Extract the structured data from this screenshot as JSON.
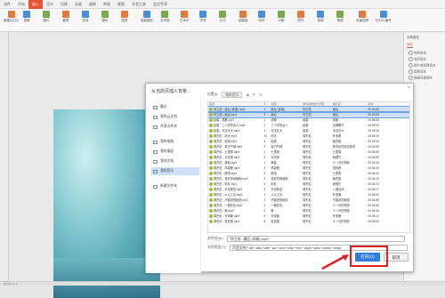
{
  "menu": [
    "文件",
    "开始",
    "插入",
    "设计",
    "切换",
    "动画",
    "放映",
    "审阅",
    "视图",
    "开发工具",
    "会员专享"
  ],
  "menu_active": "插入",
  "ribbon_buttons": [
    "新建幻灯片",
    "表格",
    "图片",
    "截屏",
    "形状",
    "图标",
    "图表",
    "智能图形",
    "文本框",
    "艺术字",
    "符号",
    "公式",
    "超链接",
    "动作",
    "对象",
    "附件",
    "音频",
    "视频",
    "页眉页脚",
    "幻灯片编号"
  ],
  "right_panel": {
    "title": "对象属性",
    "tab": "填充",
    "options": [
      "纯色填充",
      "渐变填充",
      "图片或纹理填充",
      "图案填充",
      "隐藏背景图形"
    ]
  },
  "dialog": {
    "title": "从当前页插入背景...",
    "close_label": "×",
    "sidebar": [
      "最近",
      "我的云文档",
      "共享文件夹",
      "我的电脑",
      "我的桌面",
      "我的文档",
      "我的音乐",
      "新建文件夹"
    ],
    "sidebar_selected": 6,
    "location_label": "位置(I):",
    "folder": "我的音乐",
    "columns": [
      "名称",
      "#",
      "标题",
      "参与创作的艺术家",
      "唱片集",
      "时长"
    ],
    "files": [
      {
        "name": "你立刻 - 最后 (伴奏).mp3",
        "num": "4",
        "title": "最后 (伴奏)",
        "artist": "你立刻",
        "album": "最后",
        "dur": "00:03:56",
        "sel": true
      },
      {
        "name": "你立刻 - 最后.mp3",
        "num": "4",
        "title": "最后",
        "artist": "你立刻",
        "album": "最后",
        "dur": "00:03:56",
        "sel": true
      },
      {
        "name": "赵雷 - 成都.mp3",
        "num": "1",
        "title": "成都",
        "artist": "赵雷",
        "album": "成都",
        "dur": "00:05:28",
        "sel": false
      },
      {
        "name": "赵雷 - 三十岁的女人.mp3",
        "num": "2",
        "title": "三十岁的女人",
        "artist": "赵雷",
        "album": "吉姆餐厅",
        "dur": "00:05:34",
        "sel": false
      },
      {
        "name": "赵雷 - 无法长大.mp3",
        "num": "3",
        "title": "无法长大",
        "artist": "赵雷",
        "album": "无法长大",
        "dur": "00:03:46",
        "sel": false
      },
      {
        "name": "周杰伦 - 晴天.mp3",
        "num": "10",
        "title": "晴天",
        "artist": "周杰伦",
        "album": "叶惠美",
        "dur": "00:04:29",
        "sel": false
      },
      {
        "name": "周杰伦 - 稻香.mp3",
        "num": "4",
        "title": "稻香",
        "artist": "周杰伦",
        "album": "魔杰座",
        "dur": "00:03:43",
        "sel": false
      },
      {
        "name": "周杰伦 - 告白气球.mp3",
        "num": "9",
        "title": "告白气球",
        "artist": "周杰伦",
        "album": "周杰伦的床边故事",
        "dur": "00:03:35",
        "sel": false
      },
      {
        "name": "周杰伦 - 七里香.mp3",
        "num": "1",
        "title": "七里香",
        "artist": "周杰伦",
        "album": "七里香",
        "dur": "00:04:59",
        "sel": false
      },
      {
        "name": "周杰伦 - 青花瓷.mp3",
        "num": "5",
        "title": "青花瓷",
        "artist": "周杰伦",
        "album": "我很忙",
        "dur": "00:03:59",
        "sel": false
      },
      {
        "name": "周杰伦 - 夜曲.mp3",
        "num": "1",
        "title": "夜曲",
        "artist": "周杰伦",
        "album": "十一月的萧邦",
        "dur": "00:03:46",
        "sel": false
      },
      {
        "name": "周杰伦 - 简单爱.mp3",
        "num": "4",
        "title": "简单爱",
        "artist": "周杰伦",
        "album": "范特西",
        "dur": "00:04:30",
        "sel": false
      },
      {
        "name": "周杰伦 - 搁浅.mp3",
        "num": "5",
        "title": "搁浅",
        "artist": "周杰伦",
        "album": "七里香",
        "dur": "00:04:00",
        "sel": false
      },
      {
        "name": "周杰伦 - 说好的幸福呢.mp3",
        "num": "2",
        "title": "说好的幸福呢",
        "artist": "周杰伦",
        "album": "魔杰座",
        "dur": "00:04:15",
        "sel": false
      },
      {
        "name": "周杰伦 - 彩虹.mp3",
        "num": "6",
        "title": "彩虹",
        "artist": "周杰伦",
        "album": "我很忙",
        "dur": "00:04:23",
        "sel": false
      },
      {
        "name": "周杰伦 - 半岛铁盒.mp3",
        "num": "3",
        "title": "半岛铁盒",
        "artist": "周杰伦",
        "album": "八度空间",
        "dur": "00:05:17",
        "sel": false
      },
      {
        "name": "周杰伦 - 以父之名.mp3",
        "num": "1",
        "title": "以父之名",
        "artist": "周杰伦",
        "album": "叶惠美",
        "dur": "00:05:42",
        "sel": false
      },
      {
        "name": "周杰伦 - 不能说的秘密.mp3",
        "num": "1",
        "title": "不能说的秘密",
        "artist": "周杰伦",
        "album": "不能说的秘密",
        "dur": "00:04:56",
        "sel": false
      },
      {
        "name": "周杰伦 - 一路向北.mp3",
        "num": "2",
        "title": "一路向北",
        "artist": "周杰伦",
        "album": "十一月的萧邦",
        "dur": "00:04:55",
        "sel": false
      },
      {
        "name": "周杰伦 - 枫.mp3",
        "num": "2",
        "title": "枫",
        "artist": "周杰伦",
        "album": "十一月的萧邦",
        "dur": "00:04:36",
        "sel": false
      },
      {
        "name": "周杰伦 - 东风破.mp3",
        "num": "5",
        "title": "东风破",
        "artist": "周杰伦",
        "album": "叶惠美",
        "dur": "00:05:14",
        "sel": false
      },
      {
        "name": "周杰伦 - 发如雪.mp3",
        "num": "5",
        "title": "发如雪",
        "artist": "周杰伦",
        "album": "十一月的萧邦",
        "dur": "00:05:00",
        "sel": false
      }
    ],
    "filename_label": "文件名(N):",
    "filename_value": "\"你立刻 - 最后 (伴奏).mp3\"",
    "filetype_label": "文件类型(T):",
    "filetype_value": "声音文件(*.aif;*.aifc;*.aiff;*.au;*.snd;*.mid;*.rmi;*.mp3;*.wav;*.wma;*.m4a)",
    "open_label": "打开(O)",
    "cancel_label": "取消"
  },
  "status": "幻灯片 1 / 1"
}
